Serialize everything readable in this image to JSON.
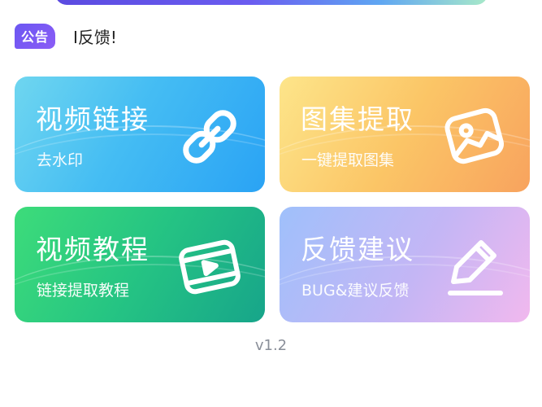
{
  "notice": {
    "badge_label": "公告",
    "text": "I反馈!"
  },
  "cards": {
    "video_link": {
      "title": "视频链接",
      "subtitle": "去水印",
      "icon": "link-icon"
    },
    "gallery": {
      "title": "图集提取",
      "subtitle": "一键提取图集",
      "icon": "image-icon"
    },
    "tutorial": {
      "title": "视频教程",
      "subtitle": "链接提取教程",
      "icon": "video-play-icon"
    },
    "feedback": {
      "title": "反馈建议",
      "subtitle": "BUG&建议反馈",
      "icon": "pen-icon"
    }
  },
  "footer": {
    "version": "v1.2"
  },
  "colors": {
    "accent_purple": "#6b57f2",
    "card_blue": "#2aa3f4",
    "card_orange": "#f8a35e",
    "card_green": "#17a58a",
    "card_lavender": "#c4b6f5"
  }
}
